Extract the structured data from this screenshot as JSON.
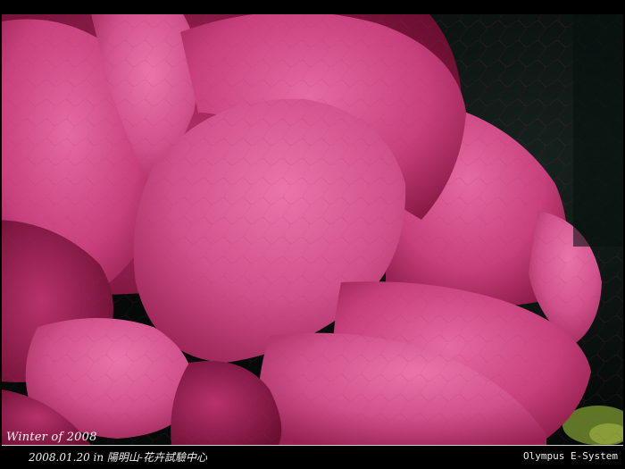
{
  "photo": {
    "subject": "pink-camellia-flower-closeup",
    "colors": {
      "petal_light": "#e0609a",
      "petal_mid": "#c23a74",
      "petal_dark": "#7a1238",
      "background": "#0b1412",
      "leaf": "#6f8a2a"
    }
  },
  "captions": {
    "season": "Winter of 2008",
    "date_location": "2008.01.20 in 陽明山-花卉試驗中心",
    "camera": "Olympus E-System"
  }
}
